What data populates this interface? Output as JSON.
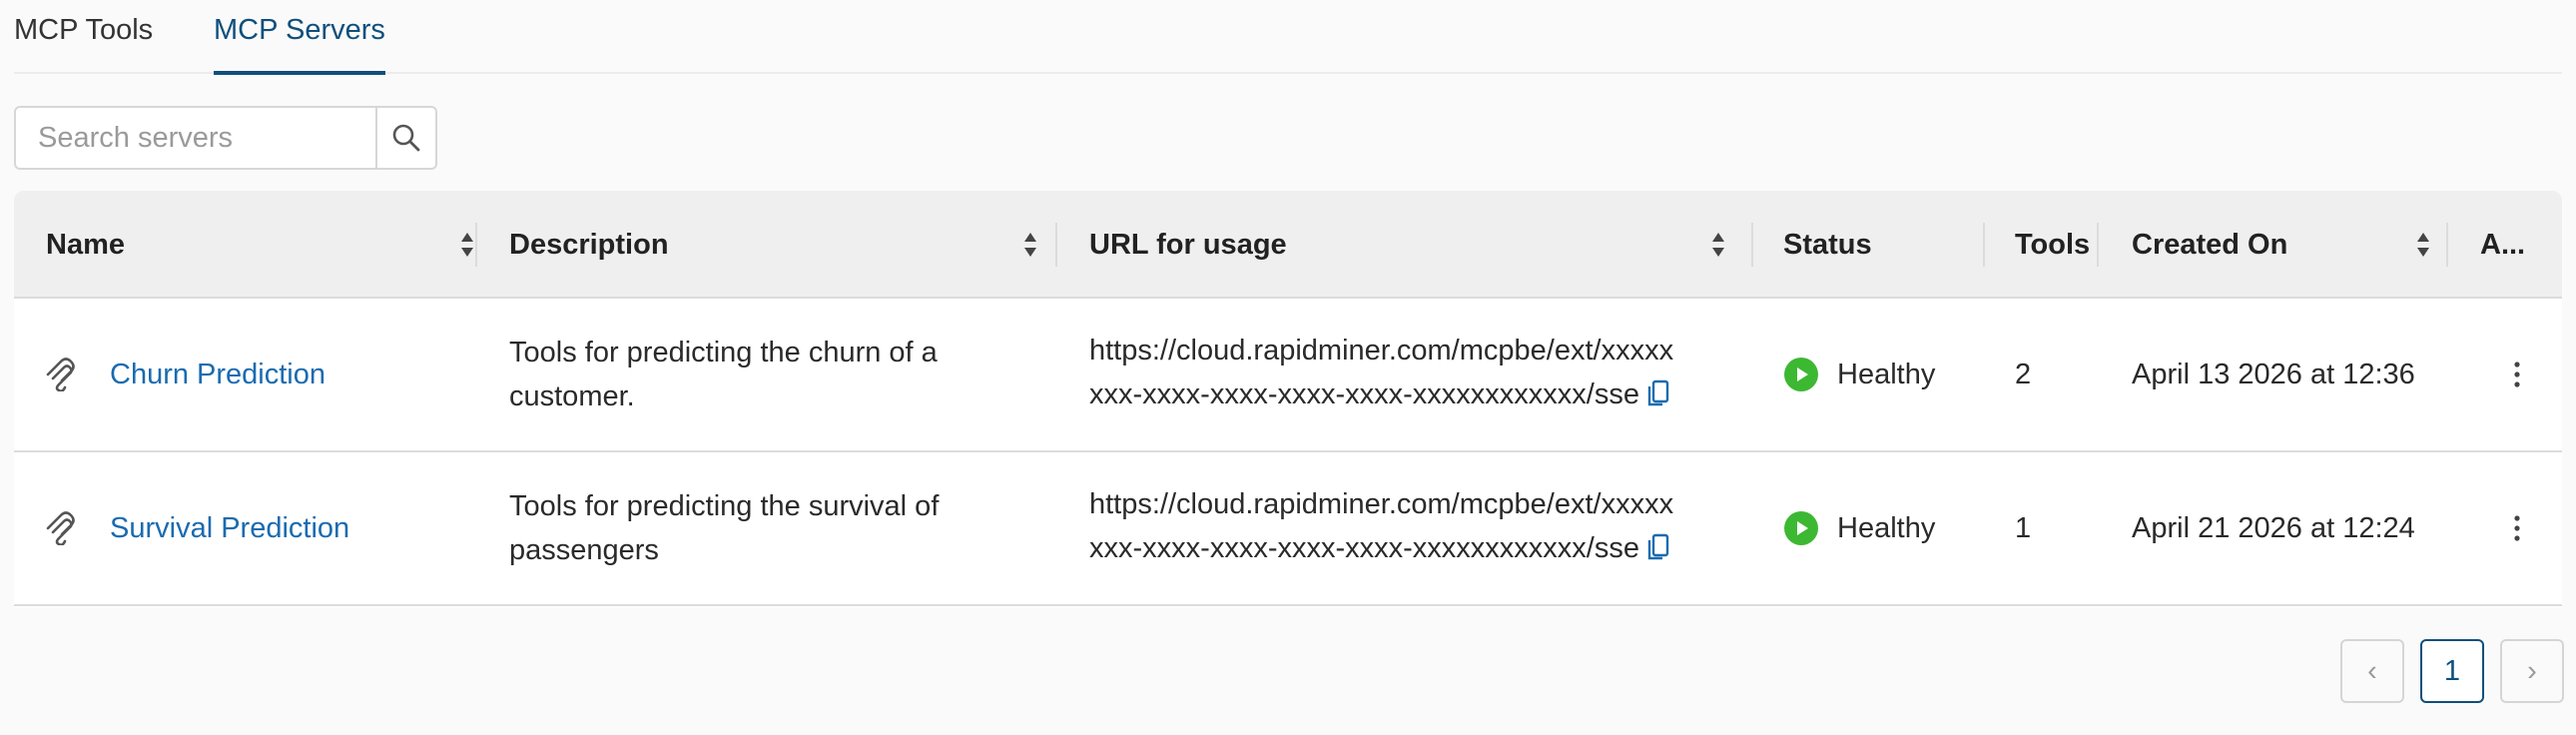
{
  "tabs": [
    {
      "label": "MCP Tools"
    },
    {
      "label": "MCP Servers"
    }
  ],
  "active_tab": "MCP Servers",
  "search": {
    "placeholder": "Search servers"
  },
  "table": {
    "columns": {
      "name": "Name",
      "description": "Description",
      "url": "URL for usage",
      "status": "Status",
      "tools": "Tools",
      "created": "Created On",
      "actions": "A..."
    },
    "rows": [
      {
        "name": "Churn Prediction",
        "description": "Tools for predicting the churn of a customer.",
        "url_line1": "https://cloud.rapidminer.com/mcpbe/ext/xxxxx",
        "url_line2": "xxx-xxxx-xxxx-xxxx-xxxx-xxxxxxxxxxxx/sse",
        "status": "Healthy",
        "tools": "2",
        "created": "April 13 2026 at 12:36"
      },
      {
        "name": "Survival Prediction",
        "description": "Tools for predicting the survival of passengers",
        "url_line1": "https://cloud.rapidminer.com/mcpbe/ext/xxxxx",
        "url_line2": "xxx-xxxx-xxxx-xxxx-xxxx-xxxxxxxxxxxx/sse",
        "status": "Healthy",
        "tools": "1",
        "created": "April 21 2026 at 12:24"
      }
    ]
  },
  "pagination": {
    "prev": "‹",
    "page": "1",
    "next": "›"
  },
  "colors": {
    "accent": "#0f4f7c",
    "link": "#1a6bb0",
    "healthy": "#3db832"
  },
  "icons": {
    "search": "search-icon",
    "sort": "sort-icon",
    "server": "mcp-server-icon",
    "copy": "copy-icon",
    "status": "play-circle-icon",
    "more": "more-vertical-icon"
  }
}
